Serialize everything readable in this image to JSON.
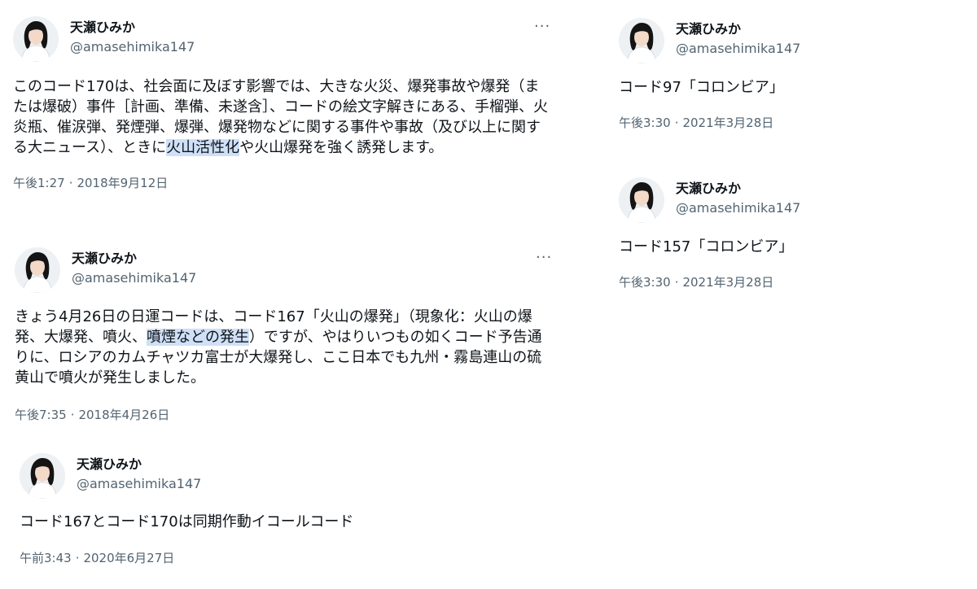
{
  "user": {
    "name": "天瀬ひみか",
    "handle": "@amasehimika147"
  },
  "more_label": "···",
  "tweets": [
    {
      "text_before": "このコード170は、社会面に及ぼす影響では、大きな火災、爆発事故や爆発（または爆破）事件［計画、準備、未遂含］、コードの絵文字解きにある、手榴弾、火炎瓶、催涙弾、発煙弾、爆弾、爆発物などに関する事件や事故（及び以上に関する大ニュース）、ときに",
      "text_highlight": "火山活性化",
      "text_after": "や火山爆発を強く誘発します。",
      "time": "午後1:27",
      "date": "2018年9月12日"
    },
    {
      "text_before": "きょう4月26日の日運コードは、コード167「火山の爆発」（現象化：火山の爆発、大爆発、噴火、",
      "text_highlight": "噴煙などの発生",
      "text_after": "）ですが、やはりいつもの如くコード予告通りに、ロシアのカムチャツカ富士が大爆発し、ここ日本でも九州・霧島連山の硫黄山で噴火が発生しました。",
      "time": "午後7:35",
      "date": "2018年4月26日"
    },
    {
      "text": "コード167とコード170は同期作動イコールコード",
      "time": "午前3:43",
      "date": "2020年6月27日"
    },
    {
      "text": "コード97「コロンビア」",
      "time": "午後3:30",
      "date": "2021年3月28日"
    },
    {
      "text": "コード157「コロンビア」",
      "time": "午後3:30",
      "date": "2021年3月28日"
    }
  ]
}
